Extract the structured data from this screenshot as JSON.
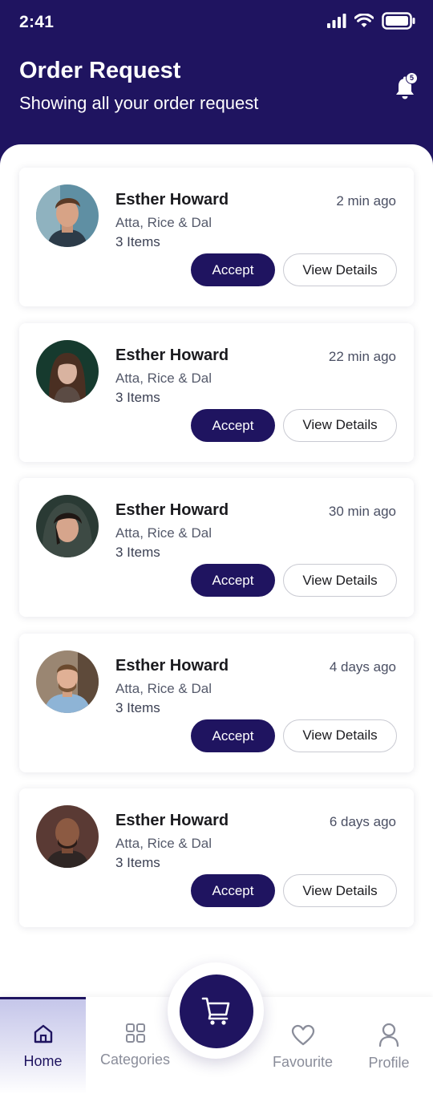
{
  "status_bar": {
    "time": "2:41"
  },
  "header": {
    "title": "Order Request",
    "subtitle": "Showing all your order request",
    "notification_count": "5"
  },
  "orders": [
    {
      "name": "Esther Howard",
      "time": "2 min ago",
      "products": "Atta, Rice & Dal",
      "count": "3 Items",
      "accept_label": "Accept",
      "details_label": "View Details"
    },
    {
      "name": "Esther Howard",
      "time": "22 min ago",
      "products": "Atta, Rice & Dal",
      "count": "3 Items",
      "accept_label": "Accept",
      "details_label": "View Details"
    },
    {
      "name": "Esther Howard",
      "time": "30 min ago",
      "products": "Atta, Rice & Dal",
      "count": "3 Items",
      "accept_label": "Accept",
      "details_label": "View Details"
    },
    {
      "name": "Esther Howard",
      "time": "4 days ago",
      "products": "Atta, Rice & Dal",
      "count": "3 Items",
      "accept_label": "Accept",
      "details_label": "View Details"
    },
    {
      "name": "Esther Howard",
      "time": "6 days ago",
      "products": "Atta, Rice & Dal",
      "count": "3 Items",
      "accept_label": "Accept",
      "details_label": "View Details"
    }
  ],
  "bottom_nav": {
    "items": [
      {
        "label": "Home",
        "icon": "home-icon",
        "active": true
      },
      {
        "label": "Categories",
        "icon": "grid-icon",
        "active": false
      },
      {
        "label": "Favourite",
        "icon": "heart-icon",
        "active": false
      },
      {
        "label": "Profile",
        "icon": "user-icon",
        "active": false
      }
    ],
    "center_icon": "cart-icon"
  },
  "colors": {
    "primary": "#1f1460",
    "background": "#ffffff",
    "muted_text": "#8a8d9a"
  }
}
